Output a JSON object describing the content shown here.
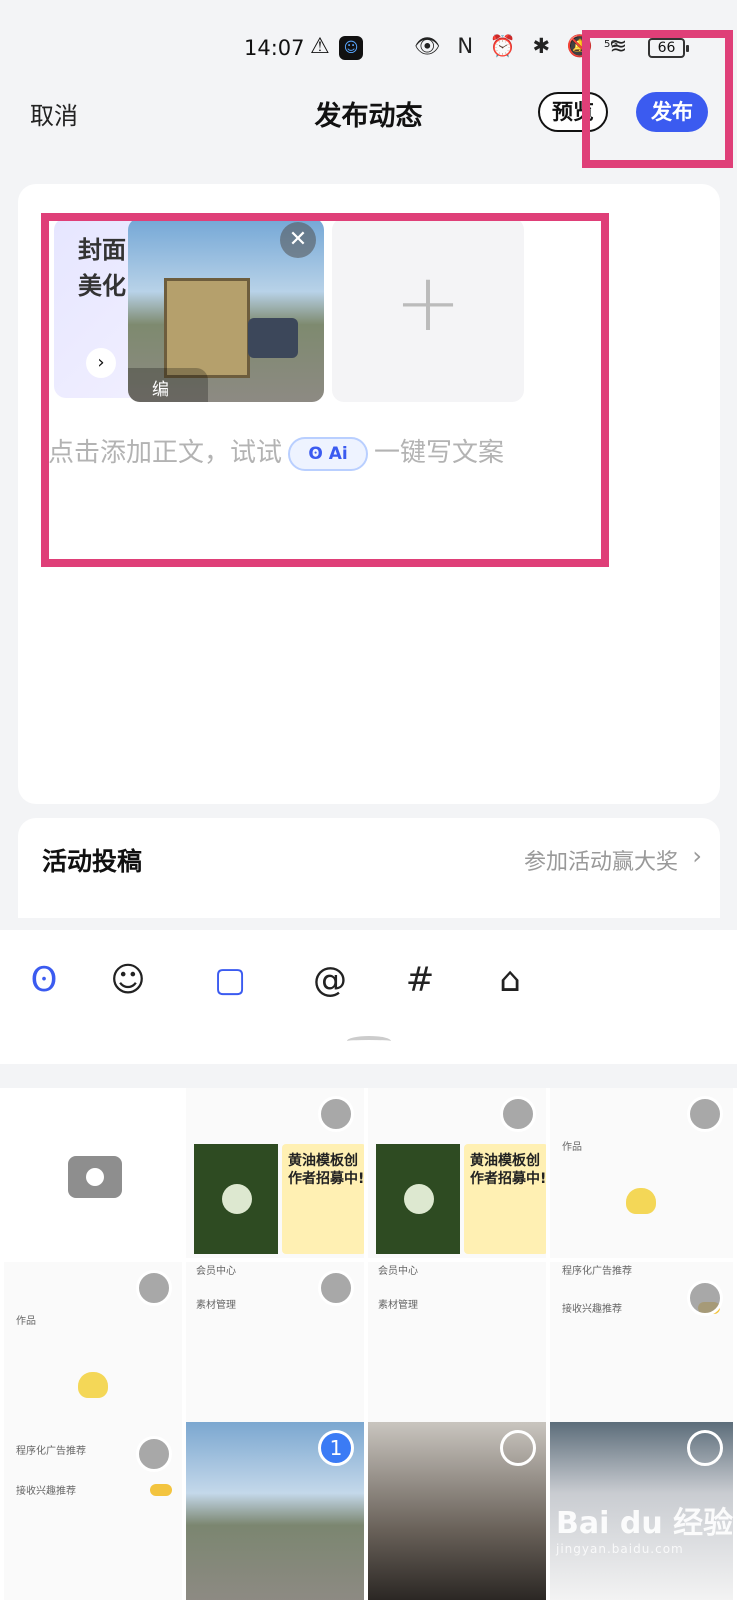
{
  "status_bar": {
    "time": "14:07",
    "network": "5G",
    "battery": "66"
  },
  "header": {
    "cancel_label": "取消",
    "title": "发布动态",
    "preview_label": "预览",
    "publish_label": "发布"
  },
  "editor": {
    "cover_beautify_label": "封面美化",
    "photo_edit_label": "编辑",
    "body_placeholder_prefix": "点击添加正文，试试",
    "ai_chip_label": "Ai",
    "body_placeholder_suffix": "一键写文案"
  },
  "activity": {
    "label": "活动投稿",
    "link_text": "参加活动赢大奖"
  },
  "toolbar": {
    "icons": [
      "ai-assistant-icon",
      "emoji-icon",
      "image-icon",
      "mention-icon",
      "hashtag-icon",
      "shopping-bag-icon"
    ]
  },
  "gallery": {
    "thumb_texts": {
      "recruit_title": "黄油模板创作者招募中!",
      "member_center": "会员中心",
      "material_manage": "素材管理",
      "works_tab": "作品",
      "ad_recommend": "程序化广告推荐",
      "interest_recommend": "接收兴趣推荐"
    },
    "selected_index": "1"
  },
  "watermark": {
    "brand": "Bai du 经验",
    "url": "jingyan.baidu.com"
  },
  "colors": {
    "accent": "#3b5bf0",
    "highlight": "#df3f78"
  }
}
